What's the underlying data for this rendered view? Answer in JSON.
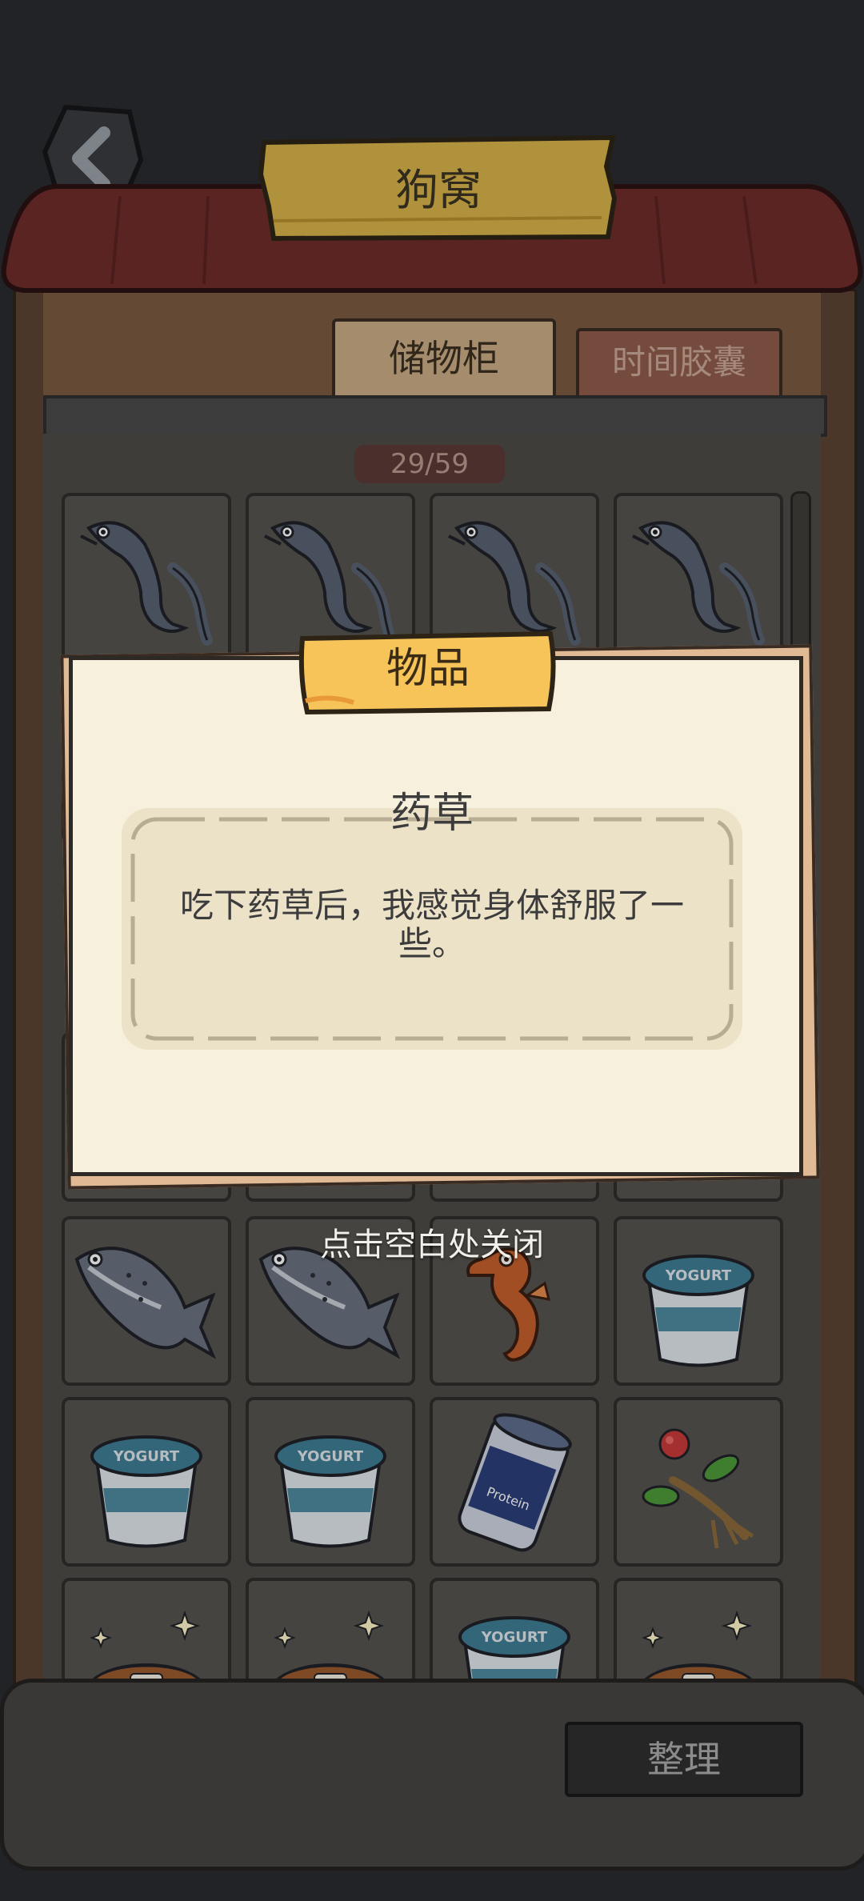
{
  "header": {
    "title": "狗窝"
  },
  "tabs": [
    {
      "label": "储物柜",
      "active": true
    },
    {
      "label": "时间胶囊",
      "active": false
    }
  ],
  "storage": {
    "count": "29/59",
    "slots": [
      {
        "item": "eel-icon"
      },
      {
        "item": "eel-icon"
      },
      {
        "item": "eel-icon"
      },
      {
        "item": "eel-icon"
      },
      {
        "item": "unknown"
      },
      {
        "item": "unknown"
      },
      {
        "item": "unknown"
      },
      {
        "item": "unknown"
      },
      {
        "item": "unknown"
      },
      {
        "item": "unknown"
      },
      {
        "item": "unknown"
      },
      {
        "item": "unknown"
      },
      {
        "item": "salmon-icon"
      },
      {
        "item": "salmon-icon"
      },
      {
        "item": "seahorse-icon"
      },
      {
        "item": "yogurt-icon"
      },
      {
        "item": "yogurt-icon"
      },
      {
        "item": "yogurt-icon"
      },
      {
        "item": "protein-powder-icon"
      },
      {
        "item": "herb-icon"
      },
      {
        "item": "dog-food-bowl-icon"
      },
      {
        "item": "dog-food-bowl-icon"
      },
      {
        "item": "yogurt-icon"
      },
      {
        "item": "dog-food-bowl-icon"
      }
    ]
  },
  "dialog": {
    "ribbon_title": "物品",
    "item_name": "药草",
    "item_description": "吃下药草后，我感觉身体舒服了一些。",
    "close_hint": "点击空白处关闭"
  },
  "footer": {
    "sort_label": "整理"
  },
  "colors": {
    "wood": "#6b5037",
    "roof": "#6e2d2a",
    "sign": "#d8b24a",
    "ribbon": "#f6c458",
    "paper": "#f6f0dd"
  }
}
